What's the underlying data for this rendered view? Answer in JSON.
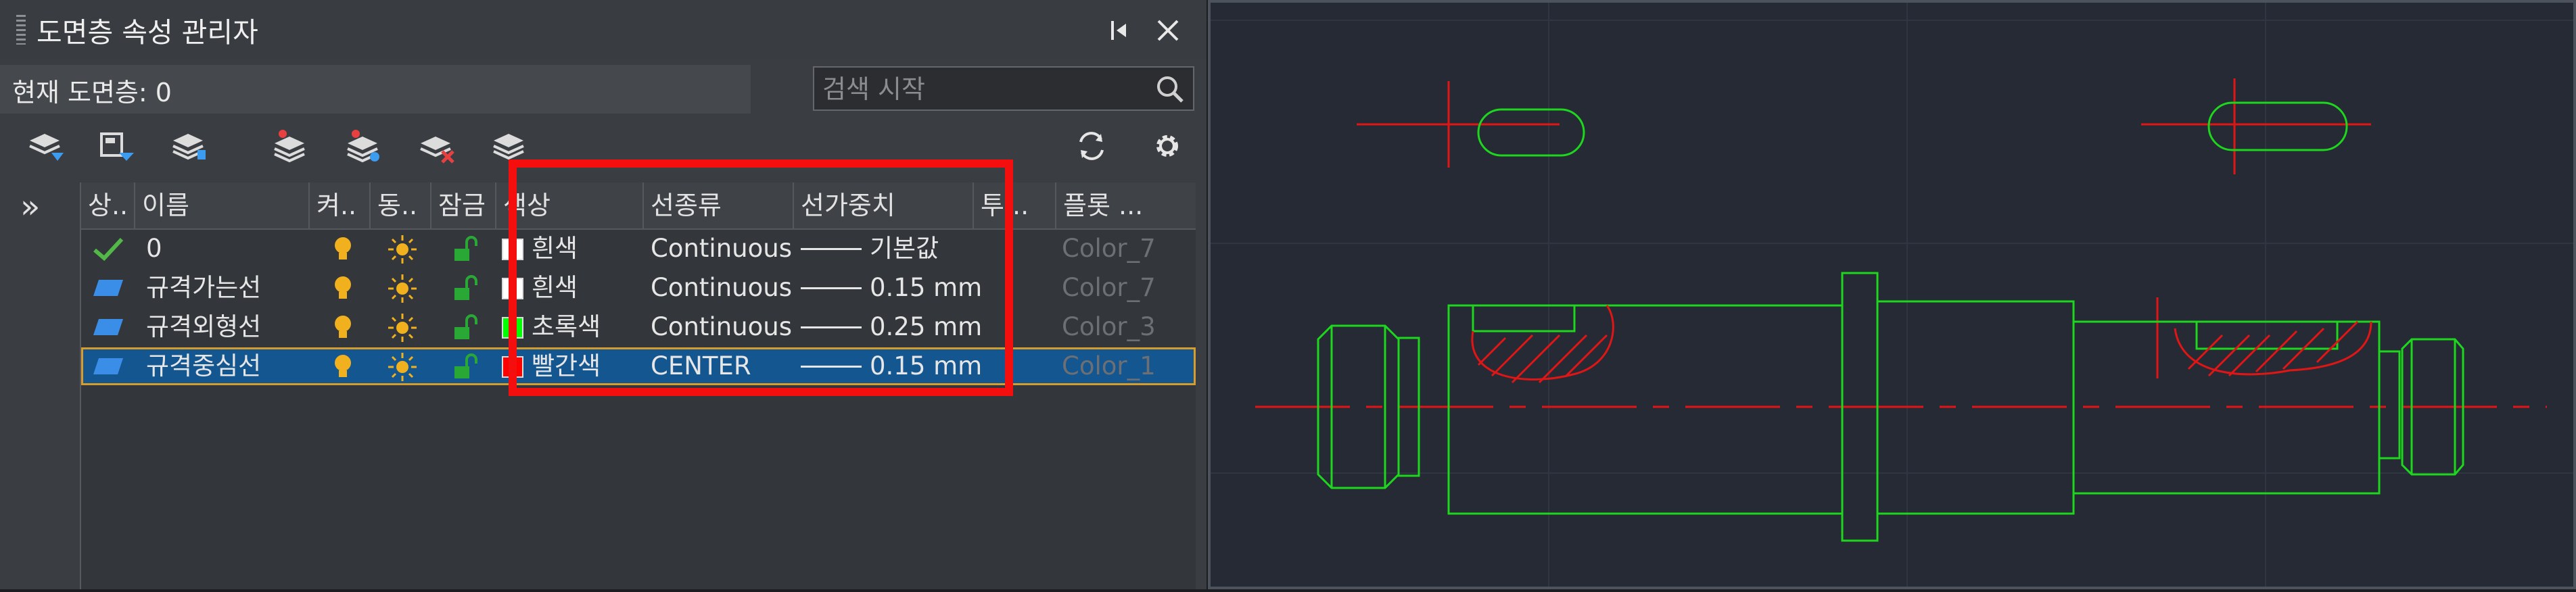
{
  "panel": {
    "title": "도면층 속성 관리자",
    "current_layer_label": "현재 도면층: 0",
    "search_placeholder": "검색 시작",
    "icons": [
      "new-layer-icon",
      "new-layer-vp-frozen-icon",
      "layer-states-icon",
      "layer-walk-icon",
      "layer-isolate-icon",
      "delete-layer-icon",
      "set-current-icon",
      "refresh-icon",
      "settings-icon",
      "auto-hide-icon",
      "close-icon",
      "expand-icon"
    ]
  },
  "columns": [
    "상..",
    "이름",
    "켜..",
    "동..",
    "잠금",
    "색상",
    "선종류",
    "선가중치",
    "투...",
    "플롯 ..."
  ],
  "layers": [
    {
      "name": "0",
      "color_name": "흰색",
      "color": "#ffffff",
      "linetype": "Continuous",
      "lineweight": "기본값",
      "plot_style": "Color_7",
      "current": true,
      "selected": false
    },
    {
      "name": "규격가는선",
      "color_name": "흰색",
      "color": "#ffffff",
      "linetype": "Continuous",
      "lineweight": "0.15 mm",
      "plot_style": "Color_7",
      "current": false,
      "selected": false
    },
    {
      "name": "규격외형선",
      "color_name": "초록색",
      "color": "#00ff00",
      "linetype": "Continuous",
      "lineweight": "0.25 mm",
      "plot_style": "Color_3",
      "current": false,
      "selected": false
    },
    {
      "name": "규격중심선",
      "color_name": "빨간색",
      "color": "#ff0000",
      "linetype": "CENTER",
      "lineweight": "0.15 mm",
      "plot_style": "Color_1",
      "current": false,
      "selected": true
    }
  ],
  "colors": {
    "highlight": "#f40e0e",
    "cad_background": "#252a34",
    "outline_green": "#1ed61e",
    "center_red": "#e01616",
    "selection": "#14568f"
  }
}
